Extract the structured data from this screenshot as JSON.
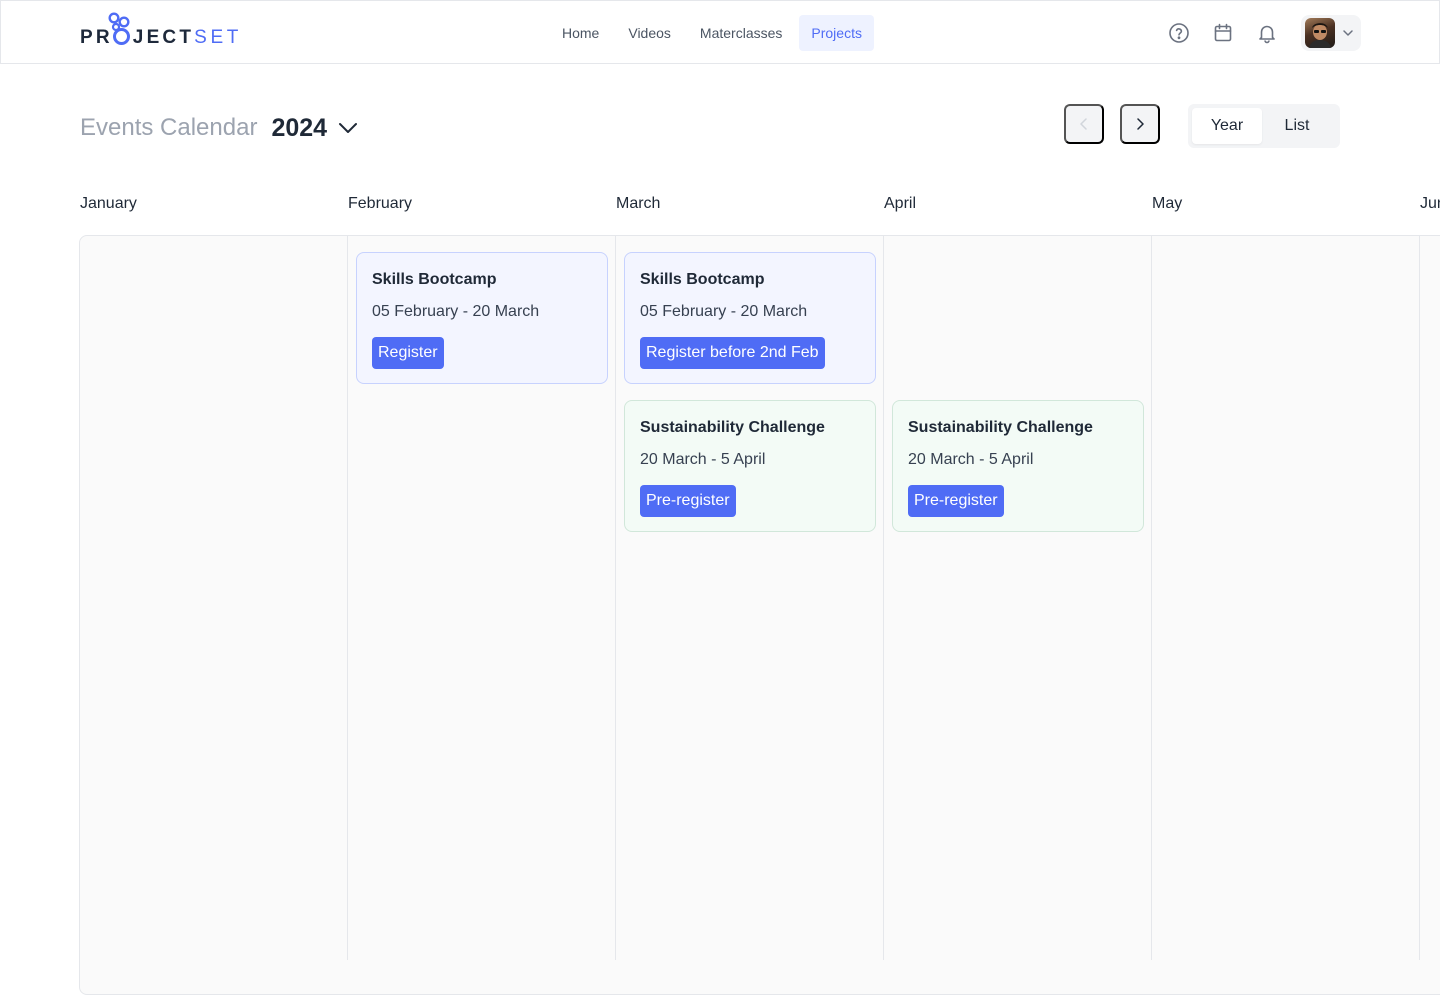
{
  "brand": {
    "part1": "PR",
    "part2": "JECT",
    "part3": "SET",
    "accent_color": "#4f6cf5"
  },
  "nav": {
    "items": [
      {
        "label": "Home",
        "active": false
      },
      {
        "label": "Videos",
        "active": false
      },
      {
        "label": "Materclasses",
        "active": false
      },
      {
        "label": "Projects",
        "active": true
      }
    ]
  },
  "header_icons": [
    "help-circle-icon",
    "calendar-icon",
    "bell-icon"
  ],
  "page": {
    "title": "Events Calendar",
    "year": "2024"
  },
  "view_toggle": {
    "options": [
      "Year",
      "List"
    ],
    "selected": "Year"
  },
  "months": [
    "January",
    "February",
    "March",
    "April",
    "May",
    "Jun"
  ],
  "events": [
    {
      "title": "Skills Bootcamp",
      "dates": "05 February - 20 March",
      "button": "Register",
      "color": "blue"
    },
    {
      "title": "Skills Bootcamp",
      "dates": "05 February - 20 March",
      "button": "Register before 2nd Feb",
      "color": "blue"
    },
    {
      "title": "Sustainability Challenge",
      "dates": "20 March - 5 April",
      "button": "Pre-register",
      "color": "green"
    },
    {
      "title": "Sustainability Challenge",
      "dates": "20 March - 5 April",
      "button": "Pre-register",
      "color": "green"
    }
  ]
}
